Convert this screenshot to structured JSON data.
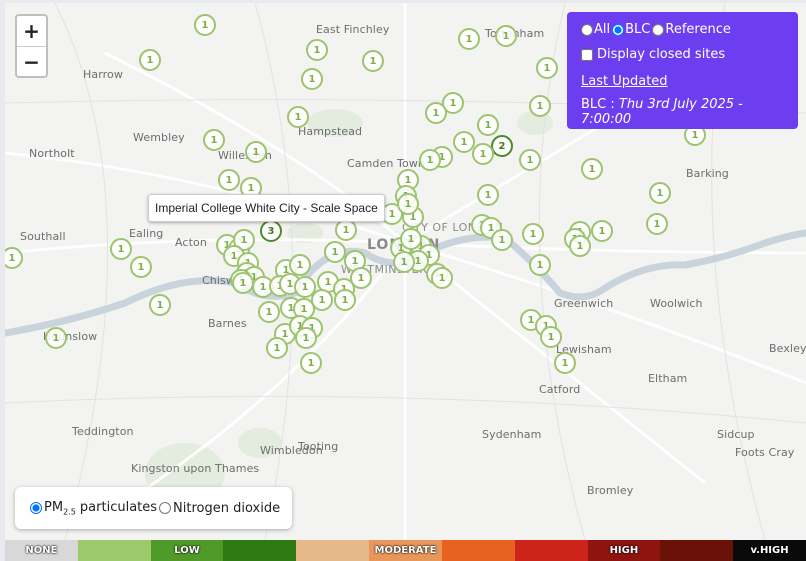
{
  "zoom": {
    "in_label": "+",
    "out_label": "−"
  },
  "panel": {
    "filters": [
      {
        "label": "All",
        "selected": false
      },
      {
        "label": "BLC",
        "selected": true
      },
      {
        "label": "Reference",
        "selected": false
      }
    ],
    "closed_sites_label": "Display closed sites",
    "closed_sites_checked": false,
    "last_updated_label": "Last Updated",
    "update_prefix": "BLC :",
    "update_time": "Thu 3rd July 2025 - 7:00:00",
    "background_color": "#6c3ef0"
  },
  "tooltip": {
    "text": "Imperial College White City - Scale Space"
  },
  "pollutant": {
    "pm_label": "PM",
    "pm_sub": "2.5",
    "pm_suffix": " particulates",
    "no2_label": "Nitrogen dioxide",
    "selected": "pm25"
  },
  "legend": [
    {
      "label": "NONE",
      "color": "#d8d8d8"
    },
    {
      "label": "",
      "color": "#9bc96b"
    },
    {
      "label": "LOW",
      "color": "#4f9a28"
    },
    {
      "label": "",
      "color": "#2e7a12"
    },
    {
      "label": "",
      "color": "#e6b98a"
    },
    {
      "label": "MODERATE",
      "color": "#e8965a"
    },
    {
      "label": "",
      "color": "#e6621e"
    },
    {
      "label": "",
      "color": "#cc2418"
    },
    {
      "label": "HIGH",
      "color": "#8e1410"
    },
    {
      "label": "",
      "color": "#6a1208"
    },
    {
      "label": "v.HIGH",
      "color": "#0a0a0a"
    }
  ],
  "places": [
    {
      "name": "Harrow",
      "cls": ""
    },
    {
      "name": "Wembley",
      "cls": ""
    },
    {
      "name": "Hampstead",
      "cls": ""
    },
    {
      "name": "East Finchley",
      "cls": ""
    },
    {
      "name": "Northolt",
      "cls": ""
    },
    {
      "name": "Willesden",
      "cls": ""
    },
    {
      "name": "Camden Town",
      "cls": ""
    },
    {
      "name": "Barking",
      "cls": ""
    },
    {
      "name": "Southall",
      "cls": ""
    },
    {
      "name": "Ealing",
      "cls": ""
    },
    {
      "name": "Acton",
      "cls": ""
    },
    {
      "name": "LONDON",
      "cls": "big"
    },
    {
      "name": "CITY OF LONDON",
      "cls": "mid"
    },
    {
      "name": "WESTMINSTER",
      "cls": "mid"
    },
    {
      "name": "Chiswick",
      "cls": ""
    },
    {
      "name": "Barnes",
      "cls": ""
    },
    {
      "name": "Hounslow",
      "cls": ""
    },
    {
      "name": "Greenwich",
      "cls": ""
    },
    {
      "name": "Woolwich",
      "cls": ""
    },
    {
      "name": "Bexley",
      "cls": ""
    },
    {
      "name": "Lewisham",
      "cls": ""
    },
    {
      "name": "Eltham",
      "cls": ""
    },
    {
      "name": "Catford",
      "cls": ""
    },
    {
      "name": "Teddington",
      "cls": ""
    },
    {
      "name": "Wimbledon",
      "cls": ""
    },
    {
      "name": "Tooting",
      "cls": ""
    },
    {
      "name": "Sydenham",
      "cls": ""
    },
    {
      "name": "Sidcup",
      "cls": ""
    },
    {
      "name": "Foots Cray",
      "cls": ""
    },
    {
      "name": "Kingston upon Thames",
      "cls": ""
    },
    {
      "name": "Bromley",
      "cls": ""
    },
    {
      "name": "Tottenham",
      "cls": ""
    }
  ],
  "markers": [
    "1",
    "1",
    "1",
    "1",
    "1",
    "1",
    "1",
    "1",
    "1",
    "1",
    "1",
    "1",
    "1",
    "1",
    "1",
    "2",
    "1",
    "1",
    "1",
    "1",
    "1",
    "1",
    "1",
    "1",
    "1",
    "1",
    "3",
    "1",
    "1",
    "1",
    "1",
    "1",
    "1",
    "1",
    "1",
    "1",
    "1",
    "1",
    "1",
    "1",
    "1",
    "1",
    "1",
    "1",
    "1",
    "1",
    "1",
    "1",
    "1",
    "1",
    "1",
    "1",
    "1",
    "1",
    "1",
    "1",
    "1",
    "1",
    "1",
    "1",
    "1",
    "1",
    "1",
    "1",
    "1",
    "1",
    "1",
    "1",
    "1",
    "1",
    "1",
    "1",
    "1",
    "1",
    "1",
    "1",
    "1",
    "1",
    "1",
    "1",
    "1",
    "1",
    "1",
    "1",
    "1",
    "1",
    "1",
    "1",
    "1",
    "1",
    "1",
    "1"
  ]
}
